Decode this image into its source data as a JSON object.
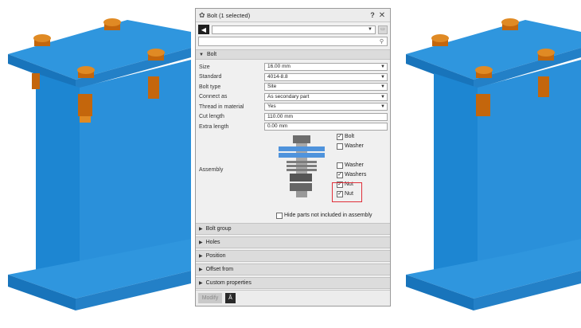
{
  "panel": {
    "title": "Bolt (1 selected)",
    "help_label": "?",
    "close_label": "✕",
    "back_label": "◀",
    "search_placeholder": ""
  },
  "sections": {
    "bolt": "Bolt",
    "collapsed": [
      "Bolt group",
      "Holes",
      "Position",
      "Offset from",
      "Custom properties"
    ]
  },
  "properties": [
    {
      "label": "Size",
      "value": "16.00 mm",
      "type": "dropdown"
    },
    {
      "label": "Standard",
      "value": "4014-8.8",
      "type": "dropdown"
    },
    {
      "label": "Bolt type",
      "value": "Site",
      "type": "dropdown"
    },
    {
      "label": "Connect as",
      "value": "As secondary part",
      "type": "dropdown"
    },
    {
      "label": "Thread in material",
      "value": "Yes",
      "type": "dropdown"
    },
    {
      "label": "Cut length",
      "value": "110.00 mm",
      "type": "text"
    },
    {
      "label": "Extra length",
      "value": "0.00 mm",
      "type": "text"
    }
  ],
  "assembly": {
    "label": "Assembly",
    "checks": [
      {
        "label": "Bolt",
        "checked": true
      },
      {
        "label": "Washer",
        "checked": false
      },
      {
        "label": "Washer",
        "checked": false
      },
      {
        "label": "Washers",
        "checked": true
      },
      {
        "label": "Nut",
        "checked": true
      },
      {
        "label": "Nut",
        "checked": true
      }
    ],
    "hide_label": "Hide parts not included in assembly",
    "hide_checked": false
  },
  "bottom": {
    "modify_label": "Modify",
    "pick_label": "Å"
  },
  "colors": {
    "steel_blue": "#1f8ad6",
    "bolt_orange": "#d97a14",
    "highlight_red": "#e0303a"
  }
}
